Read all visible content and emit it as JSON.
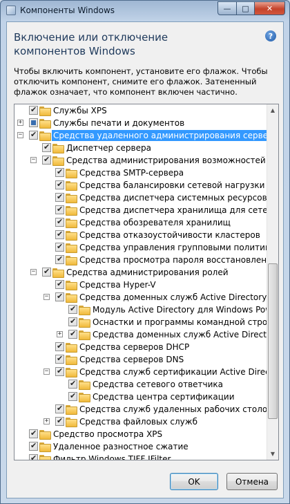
{
  "window": {
    "title": "Компоненты Windows",
    "caption_min": "—",
    "caption_max": "□",
    "caption_close": "✕"
  },
  "heading": "Включение или отключение компонентов Windows",
  "help_glyph": "?",
  "description": "Чтобы включить компонент, установите его флажок. Чтобы отключить компонент, снимите его флажок. Затененный флажок означает, что компонент включен частично.",
  "tree": {
    "items": [
      {
        "label": "Службы XPS",
        "level": 0,
        "expander": "",
        "check": "on",
        "selected": false
      },
      {
        "label": "Службы печати и документов",
        "level": 0,
        "expander": "+",
        "check": "partial",
        "selected": false
      },
      {
        "label": "Средства удаленного администрирования сервера",
        "level": 0,
        "expander": "−",
        "check": "on",
        "selected": true
      },
      {
        "label": "Диспетчер сервера",
        "level": 1,
        "expander": "",
        "check": "on",
        "selected": false
      },
      {
        "label": "Средства администрирования возможностей",
        "level": 1,
        "expander": "−",
        "check": "on",
        "selected": false
      },
      {
        "label": "Средства SMTP-сервера",
        "level": 2,
        "expander": "",
        "check": "on",
        "selected": false
      },
      {
        "label": "Средства балансировки сетевой нагрузки",
        "level": 2,
        "expander": "",
        "check": "on",
        "selected": false
      },
      {
        "label": "Средства диспетчера системных ресурсов",
        "level": 2,
        "expander": "",
        "check": "on",
        "selected": false
      },
      {
        "label": "Средства диспетчера хранилища для сетей SAN",
        "level": 2,
        "expander": "",
        "check": "on",
        "selected": false
      },
      {
        "label": "Средства обозревателя хранилищ",
        "level": 2,
        "expander": "",
        "check": "on",
        "selected": false
      },
      {
        "label": "Средства отказоустойчивости кластеров",
        "level": 2,
        "expander": "",
        "check": "on",
        "selected": false
      },
      {
        "label": "Средства управления групповыми политиками",
        "level": 2,
        "expander": "",
        "check": "on",
        "selected": false
      },
      {
        "label": "Средства просмотра пароля восстановления BitLocker",
        "level": 2,
        "expander": "",
        "check": "on",
        "selected": false
      },
      {
        "label": "Средства администрирования ролей",
        "level": 1,
        "expander": "−",
        "check": "on",
        "selected": false
      },
      {
        "label": "Средства Hyper-V",
        "level": 2,
        "expander": "",
        "check": "on",
        "selected": false
      },
      {
        "label": "Средства доменных служб Active Directory и служб AD LDS",
        "level": 2,
        "expander": "−",
        "check": "on",
        "selected": false
      },
      {
        "label": "Модуль Active Directory для Windows PowerShell",
        "level": 3,
        "expander": "",
        "check": "on",
        "selected": false
      },
      {
        "label": "Оснастки и программы командной строки служб AD DS",
        "level": 3,
        "expander": "",
        "check": "on",
        "selected": false
      },
      {
        "label": "Средства доменных служб Active Directory",
        "level": 3,
        "expander": "+",
        "check": "on",
        "selected": false
      },
      {
        "label": "Средства серверов DHCP",
        "level": 2,
        "expander": "",
        "check": "on",
        "selected": false
      },
      {
        "label": "Средства серверов DNS",
        "level": 2,
        "expander": "",
        "check": "on",
        "selected": false
      },
      {
        "label": "Средства служб сертификации Active Directory",
        "level": 2,
        "expander": "−",
        "check": "on",
        "selected": false
      },
      {
        "label": "Средства сетевого ответчика",
        "level": 3,
        "expander": "",
        "check": "on",
        "selected": false
      },
      {
        "label": "Средства центра сертификации",
        "level": 3,
        "expander": "",
        "check": "on",
        "selected": false
      },
      {
        "label": "Средства служб удаленных рабочих столов",
        "level": 2,
        "expander": "",
        "check": "on",
        "selected": false
      },
      {
        "label": "Средства файловых служб",
        "level": 2,
        "expander": "+",
        "check": "on",
        "selected": false
      },
      {
        "label": "Средство просмотра XPS",
        "level": 0,
        "expander": "",
        "check": "on",
        "selected": false
      },
      {
        "label": "Удаленное разностное сжатие",
        "level": 0,
        "expander": "",
        "check": "on",
        "selected": false
      },
      {
        "label": "Фильтр Windows TIFF IFilter",
        "level": 0,
        "expander": "",
        "check": "on",
        "selected": false
      }
    ],
    "scroll_up_glyph": "▲",
    "scroll_down_glyph": "▼"
  },
  "buttons": {
    "ok": "OK",
    "cancel": "Отмена"
  },
  "colors": {
    "selection": "#3399ff",
    "heading": "#1e395b"
  }
}
